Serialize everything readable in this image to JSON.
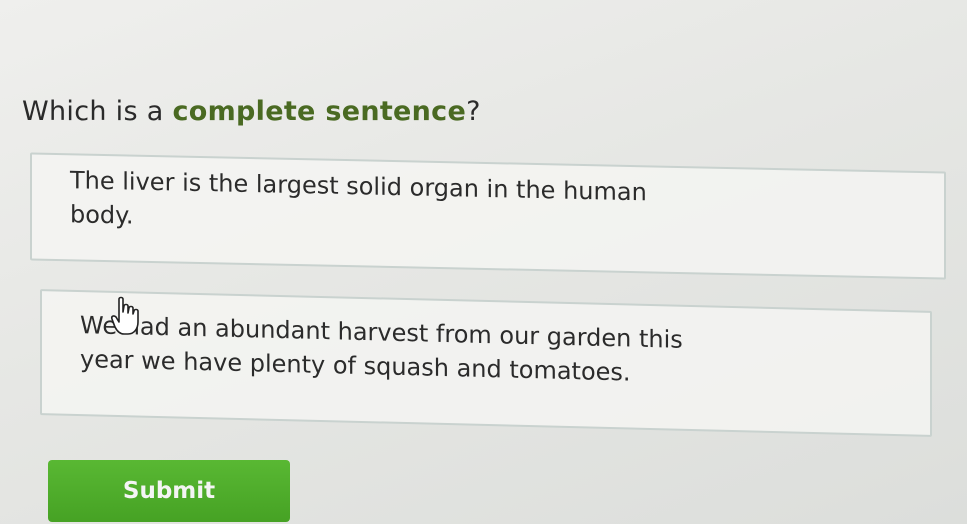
{
  "question": {
    "prefix": "Which is a ",
    "emphasis": "complete sentence",
    "suffix": "?"
  },
  "choices": [
    {
      "line1": "The liver is the largest solid organ in the human",
      "line2": "body."
    },
    {
      "line1": "We had an abundant harvest from our garden this",
      "line2": "year we have plenty of squash and tomatoes."
    }
  ],
  "submit": {
    "label": "Submit"
  },
  "colors": {
    "emphasis": "#4a6a22",
    "submit_bg": "#4faf2b",
    "choice_border": "#c9d2cf"
  },
  "icons": {
    "pointer": "hand-pointer-icon"
  }
}
